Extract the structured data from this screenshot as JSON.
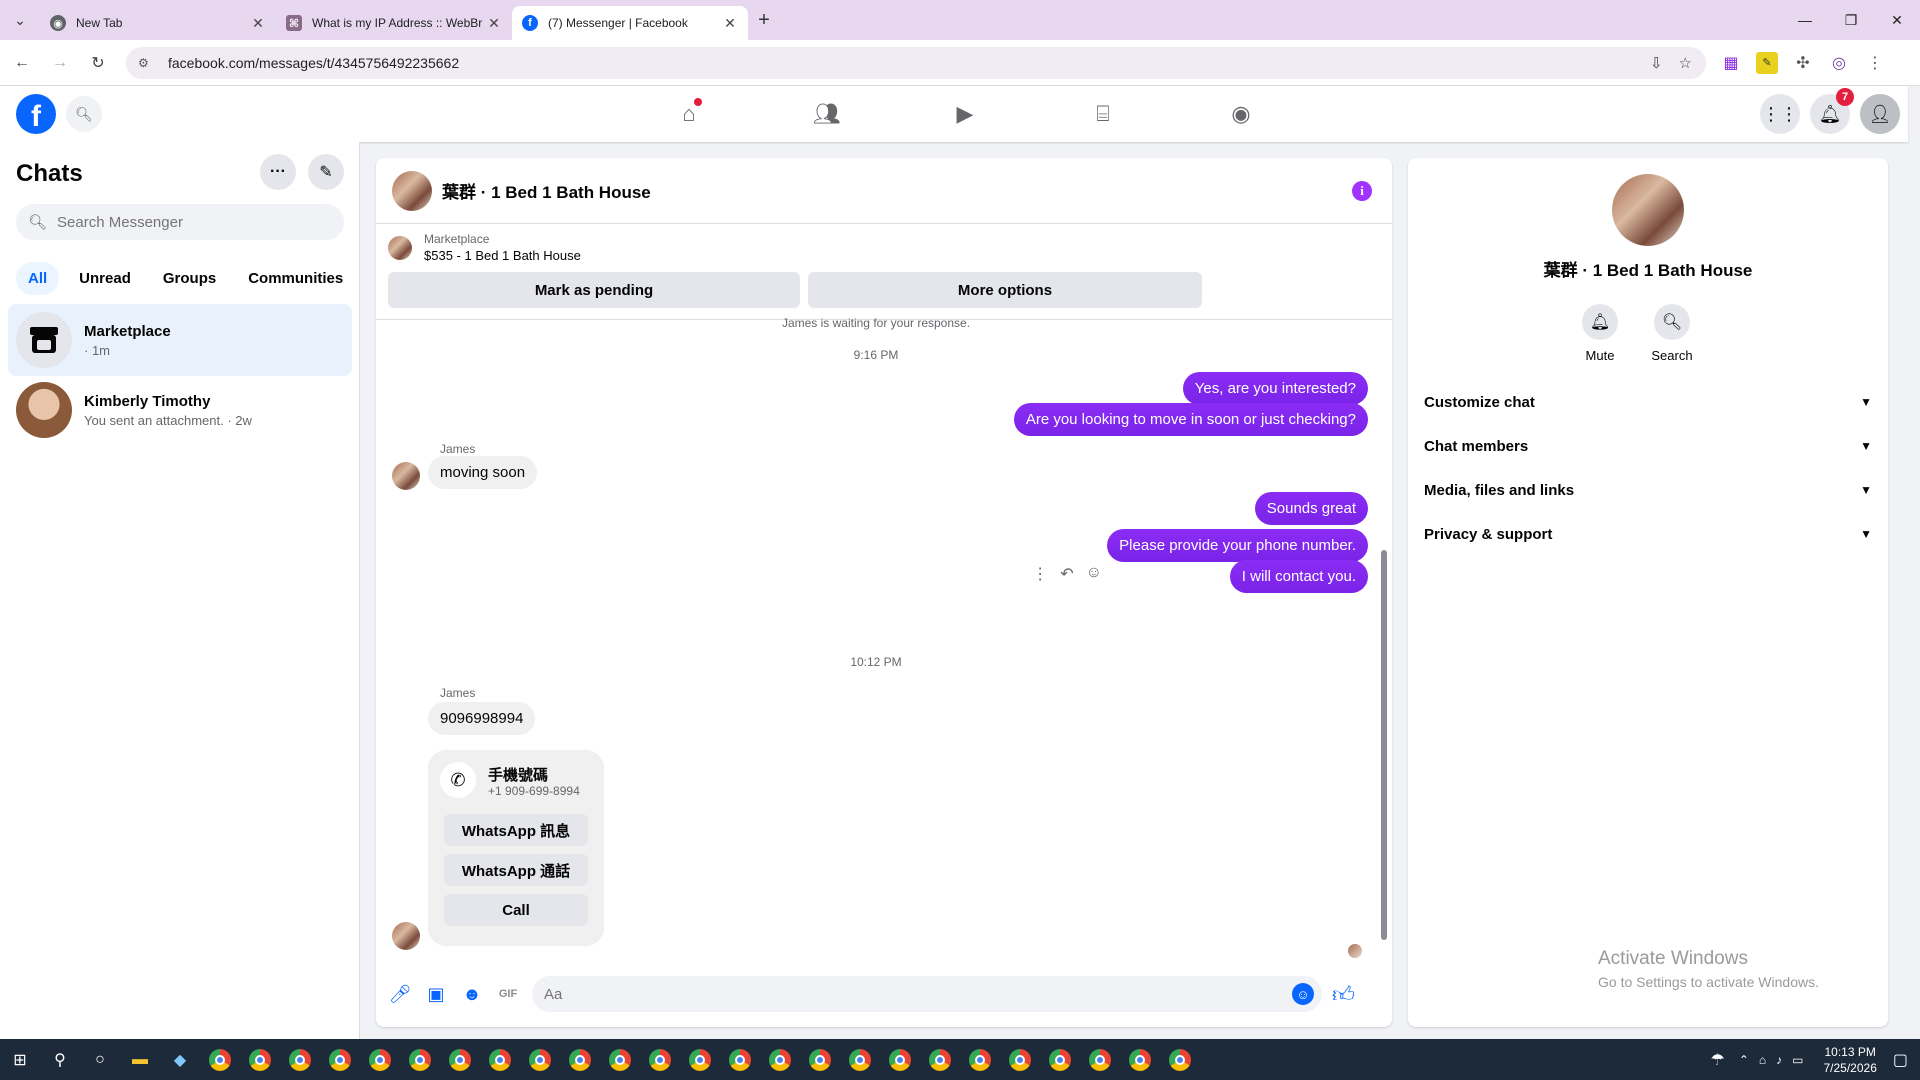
{
  "browser": {
    "tabs": [
      {
        "title": "New Tab"
      },
      {
        "title": "What is my IP Address :: WebBr"
      },
      {
        "title": "(7) Messenger | Facebook"
      }
    ],
    "url": "facebook.com/messages/t/4345756492235662"
  },
  "header": {
    "notification_count": "7"
  },
  "sidebar": {
    "title": "Chats",
    "search_placeholder": "Search Messenger",
    "filters": [
      "All",
      "Unread",
      "Groups",
      "Communities"
    ],
    "chats": [
      {
        "name": "Marketplace",
        "sub": "· 1m"
      },
      {
        "name": "Kimberly Timothy",
        "sub": "You sent an attachment. · 2w"
      }
    ]
  },
  "conversation": {
    "title": "葉群 · 1 Bed 1 Bath House",
    "marketplace_label": "Marketplace",
    "listing": "$535 - 1 Bed 1 Bath House",
    "mark_pending": "Mark as pending",
    "more_options": "More options",
    "waiting": "James is waiting for your response.",
    "time1": "9:16 PM",
    "time2": "10:12 PM",
    "messages_out_1": [
      "Yes, are you interested?",
      "Are you looking to move in soon or just checking?"
    ],
    "sender": "James",
    "msg_in_1": "moving soon",
    "messages_out_2": [
      "Sounds great",
      "Please provide your phone number.",
      "I will contact you."
    ],
    "msg_in_2": "9096998994",
    "card": {
      "title": "手機號碼",
      "number": "+1 909-699-8994",
      "buttons": [
        "WhatsApp 訊息",
        "WhatsApp 通話",
        "Call"
      ]
    },
    "composer_placeholder": "Aa"
  },
  "right_panel": {
    "name": "葉群 · 1 Bed 1 Bath House",
    "actions": [
      "Mute",
      "Search"
    ],
    "sections": [
      "Customize chat",
      "Chat members",
      "Media, files and links",
      "Privacy & support"
    ],
    "watermark_title": "Activate Windows",
    "watermark_sub": "Go to Settings to activate Windows."
  },
  "taskbar": {
    "time": "10:13 PM",
    "date": "7/25/2026"
  },
  "colors": {
    "accent": "#0866ff",
    "bubble_out": "#7a24e8",
    "tabbar": "#e7d8ef"
  }
}
